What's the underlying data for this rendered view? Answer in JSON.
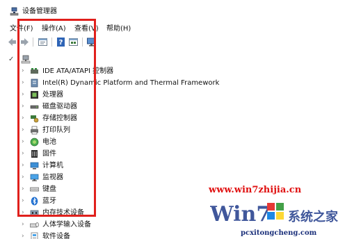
{
  "window": {
    "title": "设备管理器"
  },
  "menu": [
    {
      "label": "文件(F)"
    },
    {
      "label": "操作(A)"
    },
    {
      "label": "查看(V)"
    },
    {
      "label": "帮助(H)"
    }
  ],
  "toolbar": {
    "buttons": [
      "back-arrow-icon",
      "forward-arrow-icon",
      "properties-icon",
      "help-icon",
      "device-view-icon",
      "monitor-icon"
    ]
  },
  "tree": {
    "root_expanded": "✓",
    "collapsed_glyph": "›",
    "items": [
      {
        "label": "IDE ATA/ATAPI 控制器",
        "icon": "ide-controller-icon"
      },
      {
        "label": "Intel(R) Dynamic Platform and Thermal Framework",
        "icon": "intel-framework-icon"
      },
      {
        "label": "处理器",
        "icon": "processor-icon"
      },
      {
        "label": "磁盘驱动器",
        "icon": "disk-drive-icon"
      },
      {
        "label": "存储控制器",
        "icon": "storage-controller-icon"
      },
      {
        "label": "打印队列",
        "icon": "printer-icon"
      },
      {
        "label": "电池",
        "icon": "battery-icon"
      },
      {
        "label": "固件",
        "icon": "firmware-icon"
      },
      {
        "label": "计算机",
        "icon": "computer-icon"
      },
      {
        "label": "监视器",
        "icon": "monitor-icon"
      },
      {
        "label": "键盘",
        "icon": "keyboard-icon"
      },
      {
        "label": "蓝牙",
        "icon": "bluetooth-icon"
      },
      {
        "label": "内存技术设备",
        "icon": "memory-device-icon"
      },
      {
        "label": "人体学输入设备",
        "icon": "hid-icon"
      },
      {
        "label": "软件设备",
        "icon": "software-device-icon"
      }
    ]
  },
  "watermark": {
    "url": "www.win7zhijia.cn",
    "logo_text": "Win7系统之家",
    "domain": "pcxitongcheng.com"
  },
  "colors": {
    "highlight": "#e0201c",
    "watermark_red": "#e01010",
    "watermark_blue": "#1a2f7a"
  }
}
